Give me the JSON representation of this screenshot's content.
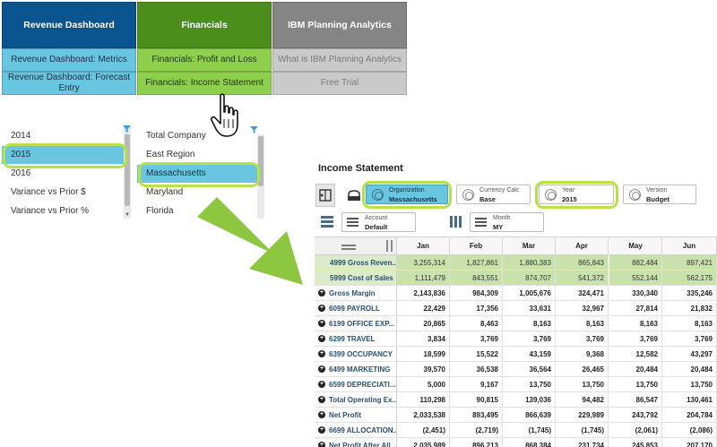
{
  "nav": {
    "columns": [
      {
        "title": "Revenue Dashboard",
        "items": [
          "Revenue Dashboard: Metrics",
          "Revenue Dashboard: Forecast Entry"
        ]
      },
      {
        "title": "Financials",
        "items": [
          "Financials: Profit and Loss",
          "Financials: Income Statement"
        ]
      },
      {
        "title": "IBM Planning Analytics",
        "items": [
          "What is IBM Planning Analytics",
          "Free Trial"
        ]
      }
    ]
  },
  "year_list": {
    "items": [
      "2014",
      "2015",
      "2016",
      "Variance vs Prior $",
      "Variance vs Prior %"
    ],
    "selected": "2015"
  },
  "region_list": {
    "items": [
      "Total Company",
      "East Region",
      "Massachusetts",
      "Maryland",
      "Florida"
    ],
    "selected": "Massachusetts"
  },
  "icons": {
    "cursor": "hand-pointer-icon",
    "arrow": "big-arrow-icon",
    "filter": "funnel-icon"
  },
  "colors": {
    "highlight": "#b6e14a",
    "selected": "#69c6e0",
    "accent_green": "#4c8e1c",
    "accent_blue": "#0a5490"
  },
  "income_statement": {
    "title": "Income Statement",
    "dimensions": [
      {
        "label": "Organization",
        "value": "Massachusetts",
        "active": true
      },
      {
        "label": "Currency Calc",
        "value": "Base",
        "active": false
      },
      {
        "label": "Year",
        "value": "2015",
        "active": false
      },
      {
        "label": "Version",
        "value": "Budget",
        "active": false
      },
      {
        "label": "Account",
        "value": "Default",
        "active": false
      },
      {
        "label": "Month",
        "value": "MY",
        "active": false
      }
    ],
    "columns": [
      "Jan",
      "Feb",
      "Mar",
      "Apr",
      "May",
      "Jun"
    ],
    "rows": [
      {
        "label": "4999 Gross Reven...",
        "expandable": false,
        "shaded": true,
        "values": [
          "3,255,314",
          "1,827,861",
          "1,880,383",
          "865,843",
          "882,484",
          "897,421"
        ]
      },
      {
        "label": "5999 Cost of Sales",
        "expandable": false,
        "shaded": true,
        "values": [
          "1,111,479",
          "843,551",
          "874,707",
          "541,372",
          "552,144",
          "562,175"
        ]
      },
      {
        "label": "Gross Margin",
        "expandable": true,
        "shaded": false,
        "values": [
          "2,143,836",
          "984,309",
          "1,005,676",
          "324,471",
          "330,340",
          "335,246"
        ]
      },
      {
        "label": "6099 PAYROLL",
        "expandable": true,
        "shaded": false,
        "values": [
          "22,429",
          "17,356",
          "33,631",
          "32,967",
          "27,814",
          "21,832"
        ]
      },
      {
        "label": "6199 OFFICE EXP...",
        "expandable": true,
        "shaded": false,
        "values": [
          "20,865",
          "8,463",
          "8,163",
          "8,163",
          "8,163",
          "8,163"
        ]
      },
      {
        "label": "6299 TRAVEL",
        "expandable": true,
        "shaded": false,
        "values": [
          "3,834",
          "3,769",
          "3,769",
          "3,769",
          "3,769",
          "3,769"
        ]
      },
      {
        "label": "6399 OCCUPANCY",
        "expandable": true,
        "shaded": false,
        "values": [
          "18,599",
          "15,522",
          "43,159",
          "9,368",
          "12,582",
          "43,297"
        ]
      },
      {
        "label": "6499 MARKETING",
        "expandable": true,
        "shaded": false,
        "values": [
          "39,570",
          "36,538",
          "36,564",
          "26,465",
          "20,484",
          "20,484"
        ]
      },
      {
        "label": "6599 DEPRECIATI...",
        "expandable": true,
        "shaded": false,
        "values": [
          "5,000",
          "9,167",
          "13,750",
          "13,750",
          "13,750",
          "13,750"
        ]
      },
      {
        "label": "Total Operating Ex...",
        "expandable": true,
        "shaded": false,
        "values": [
          "110,298",
          "90,815",
          "139,036",
          "94,482",
          "86,547",
          "130,461"
        ]
      },
      {
        "label": "Net Profit",
        "expandable": true,
        "shaded": false,
        "values": [
          "2,033,538",
          "893,495",
          "866,639",
          "229,989",
          "243,792",
          "204,784"
        ]
      },
      {
        "label": "6699 ALLOCATION...",
        "expandable": true,
        "shaded": false,
        "values": [
          "(2,451)",
          "(2,719)",
          "(1,745)",
          "(1,745)",
          "(2,061)",
          "(2,086)"
        ]
      },
      {
        "label": "Net Profit After All...",
        "expandable": true,
        "shaded": false,
        "values": [
          "2,035,989",
          "896,213",
          "868,384",
          "231,734",
          "245,853",
          "207,170"
        ]
      }
    ]
  }
}
